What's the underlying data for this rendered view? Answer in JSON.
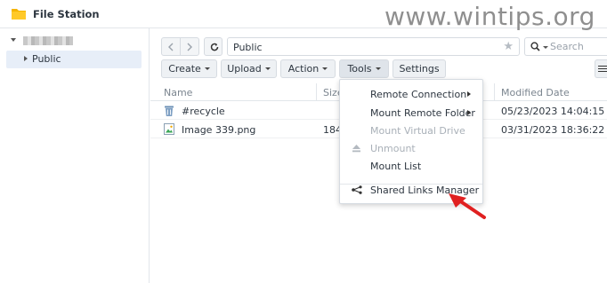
{
  "window": {
    "title": "File Station",
    "watermark": "www.wintips.org"
  },
  "sidebar": {
    "items": [
      {
        "label": "Public"
      }
    ]
  },
  "path": {
    "value": "Public"
  },
  "search": {
    "placeholder": "Search"
  },
  "toolbar": {
    "create": "Create",
    "upload": "Upload",
    "action": "Action",
    "tools": "Tools",
    "settings": "Settings"
  },
  "table": {
    "headers": [
      "Name",
      "Size",
      "Modified Date"
    ],
    "rows": [
      {
        "name": "#recycle",
        "size": "",
        "modified": "05/23/2023 14:04:15",
        "icon": "trash-icon"
      },
      {
        "name": "Image 339.png",
        "size": "184",
        "modified": "03/31/2023 18:36:22",
        "icon": "image-file-icon"
      }
    ]
  },
  "tools_menu": {
    "items": [
      {
        "label": "Remote Connection",
        "enabled": true,
        "submenu": true
      },
      {
        "label": "Mount Remote Folder",
        "enabled": true,
        "submenu": true
      },
      {
        "label": "Mount Virtual Drive",
        "enabled": false
      },
      {
        "label": "Unmount",
        "enabled": false,
        "icon": "eject-icon"
      },
      {
        "label": "Mount List",
        "enabled": true
      },
      {
        "label": "Shared Links Manager",
        "enabled": true,
        "icon": "share-icon"
      }
    ]
  },
  "colors": {
    "accent_selected": "#e7eef8",
    "folder": "#f5b400",
    "annotation_arrow": "#e02020"
  }
}
